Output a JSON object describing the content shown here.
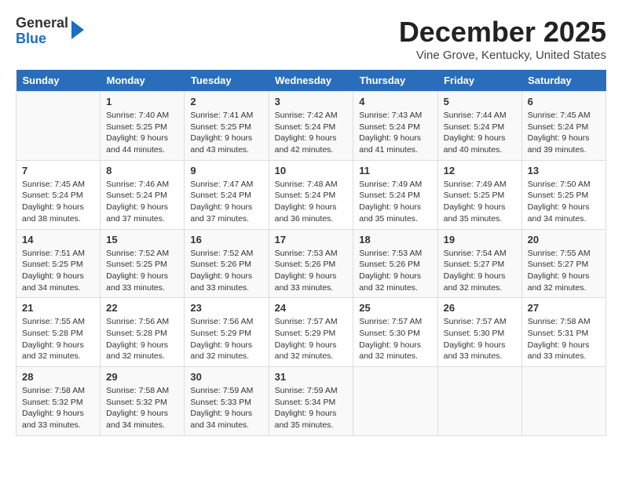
{
  "header": {
    "logo_general": "General",
    "logo_blue": "Blue",
    "month_title": "December 2025",
    "location": "Vine Grove, Kentucky, United States"
  },
  "days_of_week": [
    "Sunday",
    "Monday",
    "Tuesday",
    "Wednesday",
    "Thursday",
    "Friday",
    "Saturday"
  ],
  "weeks": [
    [
      {
        "day": "",
        "info": ""
      },
      {
        "day": "1",
        "info": "Sunrise: 7:40 AM\nSunset: 5:25 PM\nDaylight: 9 hours\nand 44 minutes."
      },
      {
        "day": "2",
        "info": "Sunrise: 7:41 AM\nSunset: 5:25 PM\nDaylight: 9 hours\nand 43 minutes."
      },
      {
        "day": "3",
        "info": "Sunrise: 7:42 AM\nSunset: 5:24 PM\nDaylight: 9 hours\nand 42 minutes."
      },
      {
        "day": "4",
        "info": "Sunrise: 7:43 AM\nSunset: 5:24 PM\nDaylight: 9 hours\nand 41 minutes."
      },
      {
        "day": "5",
        "info": "Sunrise: 7:44 AM\nSunset: 5:24 PM\nDaylight: 9 hours\nand 40 minutes."
      },
      {
        "day": "6",
        "info": "Sunrise: 7:45 AM\nSunset: 5:24 PM\nDaylight: 9 hours\nand 39 minutes."
      }
    ],
    [
      {
        "day": "7",
        "info": "Sunrise: 7:45 AM\nSunset: 5:24 PM\nDaylight: 9 hours\nand 38 minutes."
      },
      {
        "day": "8",
        "info": "Sunrise: 7:46 AM\nSunset: 5:24 PM\nDaylight: 9 hours\nand 37 minutes."
      },
      {
        "day": "9",
        "info": "Sunrise: 7:47 AM\nSunset: 5:24 PM\nDaylight: 9 hours\nand 37 minutes."
      },
      {
        "day": "10",
        "info": "Sunrise: 7:48 AM\nSunset: 5:24 PM\nDaylight: 9 hours\nand 36 minutes."
      },
      {
        "day": "11",
        "info": "Sunrise: 7:49 AM\nSunset: 5:24 PM\nDaylight: 9 hours\nand 35 minutes."
      },
      {
        "day": "12",
        "info": "Sunrise: 7:49 AM\nSunset: 5:25 PM\nDaylight: 9 hours\nand 35 minutes."
      },
      {
        "day": "13",
        "info": "Sunrise: 7:50 AM\nSunset: 5:25 PM\nDaylight: 9 hours\nand 34 minutes."
      }
    ],
    [
      {
        "day": "14",
        "info": "Sunrise: 7:51 AM\nSunset: 5:25 PM\nDaylight: 9 hours\nand 34 minutes."
      },
      {
        "day": "15",
        "info": "Sunrise: 7:52 AM\nSunset: 5:25 PM\nDaylight: 9 hours\nand 33 minutes."
      },
      {
        "day": "16",
        "info": "Sunrise: 7:52 AM\nSunset: 5:26 PM\nDaylight: 9 hours\nand 33 minutes."
      },
      {
        "day": "17",
        "info": "Sunrise: 7:53 AM\nSunset: 5:26 PM\nDaylight: 9 hours\nand 33 minutes."
      },
      {
        "day": "18",
        "info": "Sunrise: 7:53 AM\nSunset: 5:26 PM\nDaylight: 9 hours\nand 32 minutes."
      },
      {
        "day": "19",
        "info": "Sunrise: 7:54 AM\nSunset: 5:27 PM\nDaylight: 9 hours\nand 32 minutes."
      },
      {
        "day": "20",
        "info": "Sunrise: 7:55 AM\nSunset: 5:27 PM\nDaylight: 9 hours\nand 32 minutes."
      }
    ],
    [
      {
        "day": "21",
        "info": "Sunrise: 7:55 AM\nSunset: 5:28 PM\nDaylight: 9 hours\nand 32 minutes."
      },
      {
        "day": "22",
        "info": "Sunrise: 7:56 AM\nSunset: 5:28 PM\nDaylight: 9 hours\nand 32 minutes."
      },
      {
        "day": "23",
        "info": "Sunrise: 7:56 AM\nSunset: 5:29 PM\nDaylight: 9 hours\nand 32 minutes."
      },
      {
        "day": "24",
        "info": "Sunrise: 7:57 AM\nSunset: 5:29 PM\nDaylight: 9 hours\nand 32 minutes."
      },
      {
        "day": "25",
        "info": "Sunrise: 7:57 AM\nSunset: 5:30 PM\nDaylight: 9 hours\nand 32 minutes."
      },
      {
        "day": "26",
        "info": "Sunrise: 7:57 AM\nSunset: 5:30 PM\nDaylight: 9 hours\nand 33 minutes."
      },
      {
        "day": "27",
        "info": "Sunrise: 7:58 AM\nSunset: 5:31 PM\nDaylight: 9 hours\nand 33 minutes."
      }
    ],
    [
      {
        "day": "28",
        "info": "Sunrise: 7:58 AM\nSunset: 5:32 PM\nDaylight: 9 hours\nand 33 minutes."
      },
      {
        "day": "29",
        "info": "Sunrise: 7:58 AM\nSunset: 5:32 PM\nDaylight: 9 hours\nand 34 minutes."
      },
      {
        "day": "30",
        "info": "Sunrise: 7:59 AM\nSunset: 5:33 PM\nDaylight: 9 hours\nand 34 minutes."
      },
      {
        "day": "31",
        "info": "Sunrise: 7:59 AM\nSunset: 5:34 PM\nDaylight: 9 hours\nand 35 minutes."
      },
      {
        "day": "",
        "info": ""
      },
      {
        "day": "",
        "info": ""
      },
      {
        "day": "",
        "info": ""
      }
    ]
  ]
}
